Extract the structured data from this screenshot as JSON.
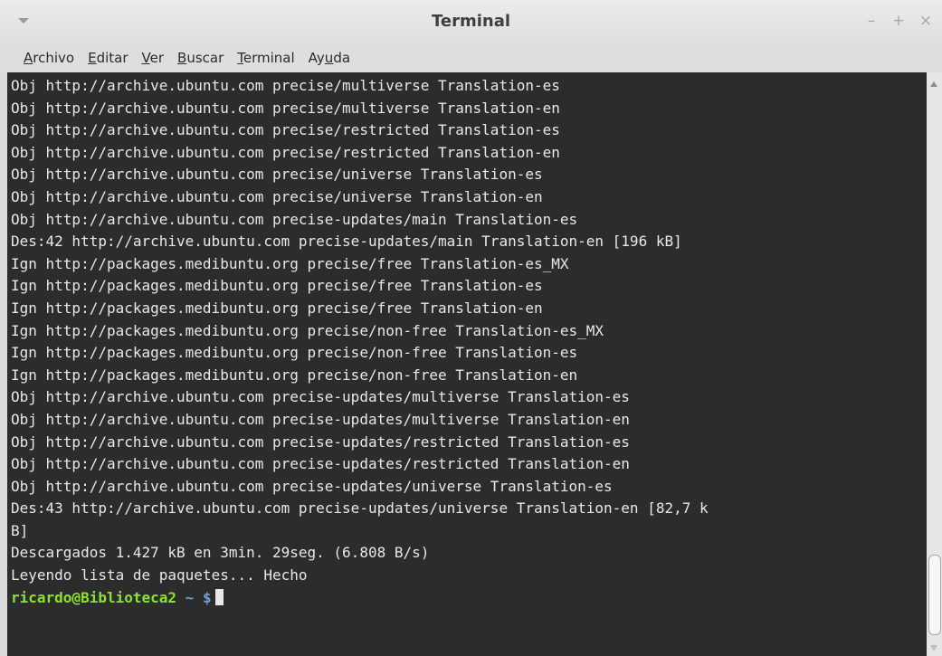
{
  "window": {
    "title": "Terminal",
    "controls": {
      "minimize": "–",
      "maximize": "+",
      "close": "×"
    }
  },
  "menu": [
    {
      "mnemonic": "A",
      "rest": "rchivo",
      "prefix": ""
    },
    {
      "mnemonic": "E",
      "rest": "ditar",
      "prefix": ""
    },
    {
      "mnemonic": "V",
      "rest": "er",
      "prefix": ""
    },
    {
      "mnemonic": "B",
      "rest": "uscar",
      "prefix": ""
    },
    {
      "mnemonic": "T",
      "rest": "erminal",
      "prefix": ""
    },
    {
      "mnemonic": "u",
      "rest": "da",
      "prefix": "Ay"
    }
  ],
  "terminal": {
    "lines": [
      "Obj http://archive.ubuntu.com precise/multiverse Translation-es",
      "Obj http://archive.ubuntu.com precise/multiverse Translation-en",
      "Obj http://archive.ubuntu.com precise/restricted Translation-es",
      "Obj http://archive.ubuntu.com precise/restricted Translation-en",
      "Obj http://archive.ubuntu.com precise/universe Translation-es",
      "Obj http://archive.ubuntu.com precise/universe Translation-en",
      "Obj http://archive.ubuntu.com precise-updates/main Translation-es",
      "Des:42 http://archive.ubuntu.com precise-updates/main Translation-en [196 kB]",
      "Ign http://packages.medibuntu.org precise/free Translation-es_MX",
      "Ign http://packages.medibuntu.org precise/free Translation-es",
      "Ign http://packages.medibuntu.org precise/free Translation-en",
      "Ign http://packages.medibuntu.org precise/non-free Translation-es_MX",
      "Ign http://packages.medibuntu.org precise/non-free Translation-es",
      "Ign http://packages.medibuntu.org precise/non-free Translation-en",
      "Obj http://archive.ubuntu.com precise-updates/multiverse Translation-es",
      "Obj http://archive.ubuntu.com precise-updates/multiverse Translation-en",
      "Obj http://archive.ubuntu.com precise-updates/restricted Translation-es",
      "Obj http://archive.ubuntu.com precise-updates/restricted Translation-en",
      "Obj http://archive.ubuntu.com precise-updates/universe Translation-es",
      "Des:43 http://archive.ubuntu.com precise-updates/universe Translation-en [82,7 k",
      "B]",
      "Descargados 1.427 kB en 3min. 29seg. (6.808 B/s)",
      "Leyendo lista de paquetes... Hecho"
    ],
    "prompt": {
      "user_host": "ricardo@Biblioteca2",
      "path": "~",
      "symbol": "$"
    }
  },
  "colors": {
    "terminal_bg": "#2c2c2c",
    "terminal_fg": "#e8e8e8",
    "prompt_user": "#8ae234",
    "prompt_path": "#729fcf"
  }
}
